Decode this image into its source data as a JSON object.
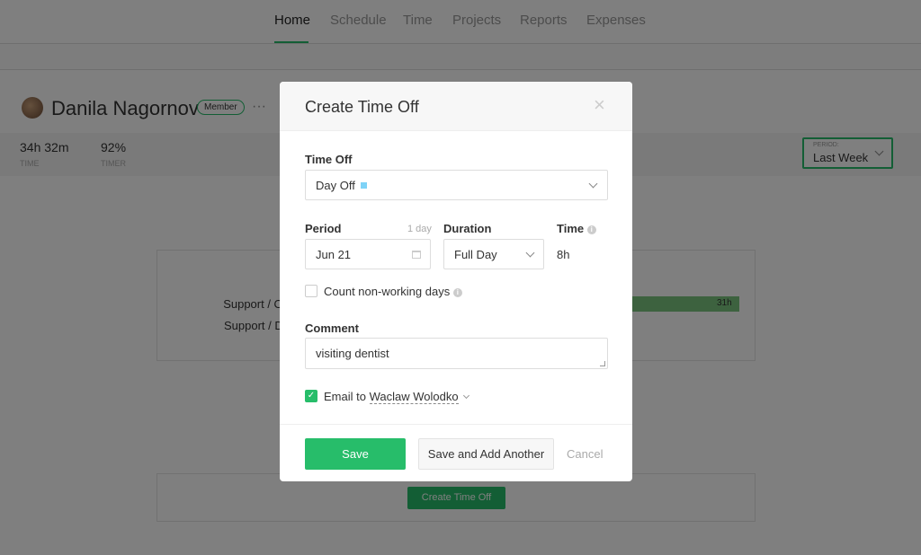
{
  "nav": {
    "items": [
      "Home",
      "Schedule",
      "Time",
      "Projects",
      "Reports",
      "Expenses"
    ],
    "active": "Home"
  },
  "profile": {
    "name": "Danila Nagornov",
    "role_badge": "Member",
    "more": "···"
  },
  "stats": [
    {
      "value": "34h 32m",
      "label": "TIME"
    },
    {
      "value": "92%",
      "label": "TIMER"
    }
  ],
  "period": {
    "label": "PERIOD:",
    "value": "Last Week"
  },
  "report": {
    "rows": [
      "Support / Or",
      "Support / D"
    ],
    "bar_value": "31h"
  },
  "create_time_off_button": "Create Time Off",
  "modal": {
    "title": "Create Time Off",
    "close": "×",
    "time_off": {
      "label": "Time Off",
      "value": "Day Off",
      "color": "#7fd3f7"
    },
    "period": {
      "label": "Period",
      "hint": "1 day",
      "value": "Jun 21"
    },
    "duration": {
      "label": "Duration",
      "value": "Full Day"
    },
    "time": {
      "label": "Time",
      "value": "8h"
    },
    "count_nonworking": {
      "label": "Count non-working days",
      "checked": false
    },
    "comment": {
      "label": "Comment",
      "value": "visiting dentist"
    },
    "email": {
      "label": "Email to",
      "recipient": "Waclaw Wolodko",
      "checked": true
    },
    "buttons": {
      "save": "Save",
      "save_add": "Save and Add Another",
      "cancel": "Cancel"
    }
  },
  "colors": {
    "accent": "#27bd6a",
    "overlay": "rgba(0,0,0,0.5)"
  }
}
